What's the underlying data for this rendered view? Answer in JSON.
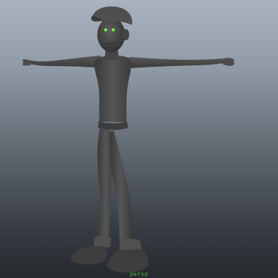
{
  "viewport": {
    "background_top": "#a9b4c0",
    "background_bottom": "#26292d",
    "model_color": "#4a4a4a",
    "eye_color": "#7cff3a",
    "status_color": "#3fbf3f"
  },
  "status": {
    "label": "persp"
  }
}
